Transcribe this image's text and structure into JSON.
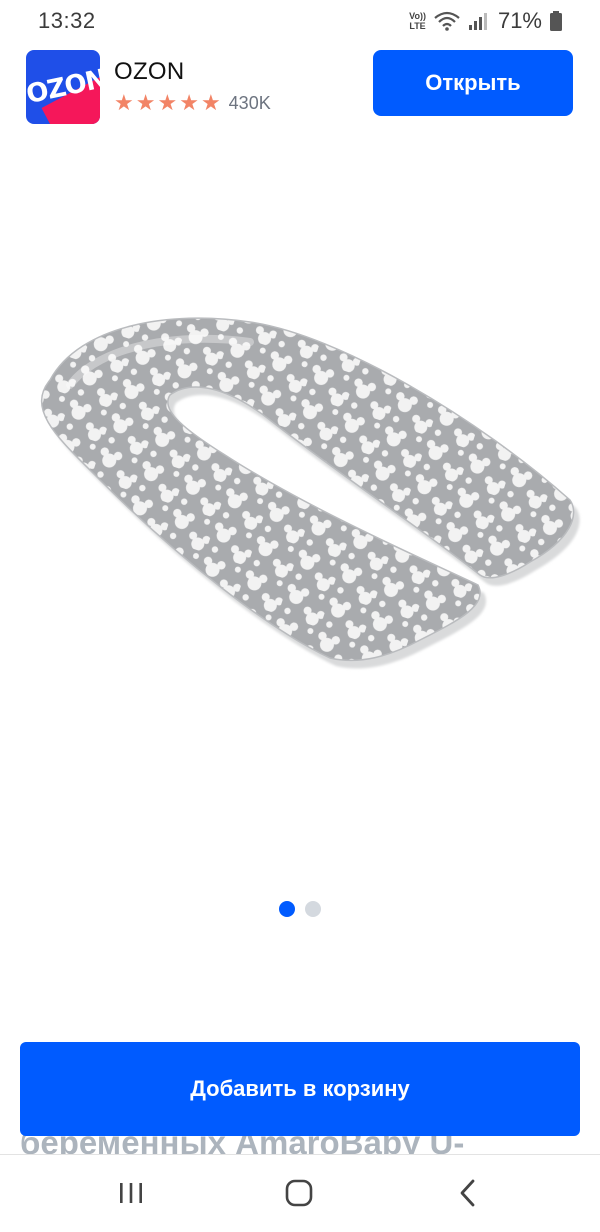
{
  "status_bar": {
    "time": "13:32",
    "volte_top": "Vo))",
    "volte_bottom": "LTE",
    "battery": "71%"
  },
  "app_banner": {
    "name": "OZON",
    "logo_text": "OZON",
    "rating_stars": 5,
    "rating_count": "430K",
    "open_label": "Открыть",
    "star_color": "#f28466"
  },
  "product": {
    "image_alt": "U-shaped pregnancy pillow",
    "carousel": {
      "total": 2,
      "active_index": 0
    },
    "title_peek": "беременных AmaroBaby U-",
    "add_to_cart_label": "Добавить в корзину"
  },
  "colors": {
    "accent": "#005bff",
    "brand_pink": "#f5175a",
    "brand_blue": "#1f4fe8"
  },
  "nav": {
    "recents_icon": "recents-icon",
    "home_icon": "home-icon",
    "back_icon": "back-icon"
  }
}
